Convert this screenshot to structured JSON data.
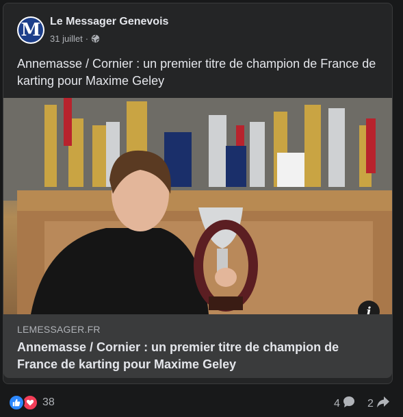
{
  "post": {
    "page_name": "Le Messager Genevois",
    "avatar_letter": "M",
    "date": "31 juillet",
    "separator": "·",
    "privacy_icon": "globe-icon",
    "caption": "Annemasse / Cornier : un premier titre de champion de France de karting pour Maxime Geley"
  },
  "media": {
    "info_label": "i"
  },
  "link": {
    "domain": "LEMESSAGER.FR",
    "title": "Annemasse / Cornier : un premier titre de champion de France de karting pour Maxime Geley"
  },
  "footer": {
    "reaction_icons": [
      "like-icon",
      "love-icon"
    ],
    "reaction_count": "38",
    "comment_count": "4",
    "share_count": "2"
  },
  "colors": {
    "background": "#18191a",
    "card": "#242526",
    "link_box": "#3a3b3c",
    "like": "#2d88ff",
    "love": "#f33e58",
    "text_primary": "#e4e6eb",
    "text_secondary": "#b0b3b8"
  }
}
